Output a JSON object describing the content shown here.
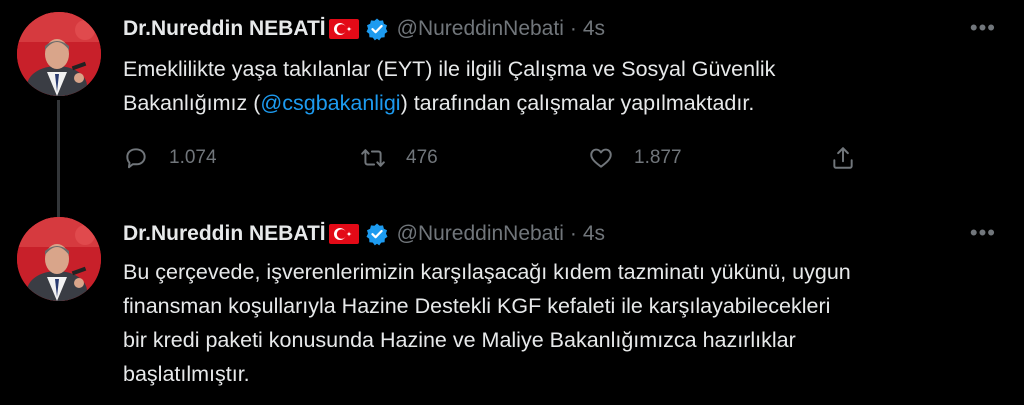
{
  "tweets": [
    {
      "author": {
        "name": "Dr.Nureddin NEBATİ",
        "handle": "@NureddinNebati",
        "avatar_icon": "profile-photo",
        "flag_icon": "turkey-flag-icon",
        "verified_icon": "verified-badge-icon"
      },
      "separator": "·",
      "time": "4s",
      "more_icon": "more-icon",
      "text_line1": "Emeklilikte yaşa takılanlar (EYT) ile ilgili Çalışma ve Sosyal Güvenlik",
      "text_line2_prefix": "Bakanlığımız (",
      "mention": "@csgbakanligi",
      "text_line2_suffix": ") tarafından çalışmalar yapılmaktadır.",
      "actions": {
        "reply_count": "1.074",
        "retweet_count": "476",
        "like_count": "1.877",
        "reply_icon": "reply-icon",
        "retweet_icon": "retweet-icon",
        "like_icon": "heart-icon",
        "share_icon": "share-icon"
      }
    },
    {
      "author": {
        "name": "Dr.Nureddin NEBATİ",
        "handle": "@NureddinNebati",
        "avatar_icon": "profile-photo",
        "flag_icon": "turkey-flag-icon",
        "verified_icon": "verified-badge-icon"
      },
      "separator": "·",
      "time": "4s",
      "more_icon": "more-icon",
      "text_lines": [
        "Bu çerçevede, işverenlerimizin karşılaşacağı kıdem tazminatı yükünü, uygun",
        "finansman koşullarıyla Hazine Destekli KGF kefaleti ile karşılayabilecekleri",
        "bir kredi paketi konusunda Hazine ve Maliye Bakanlığımızca hazırlıklar",
        "başlatılmıştır."
      ]
    }
  ],
  "colors": {
    "background": "#000000",
    "text": "#e7e9ea",
    "secondary": "#71767b",
    "accent": "#1d9bf0"
  }
}
